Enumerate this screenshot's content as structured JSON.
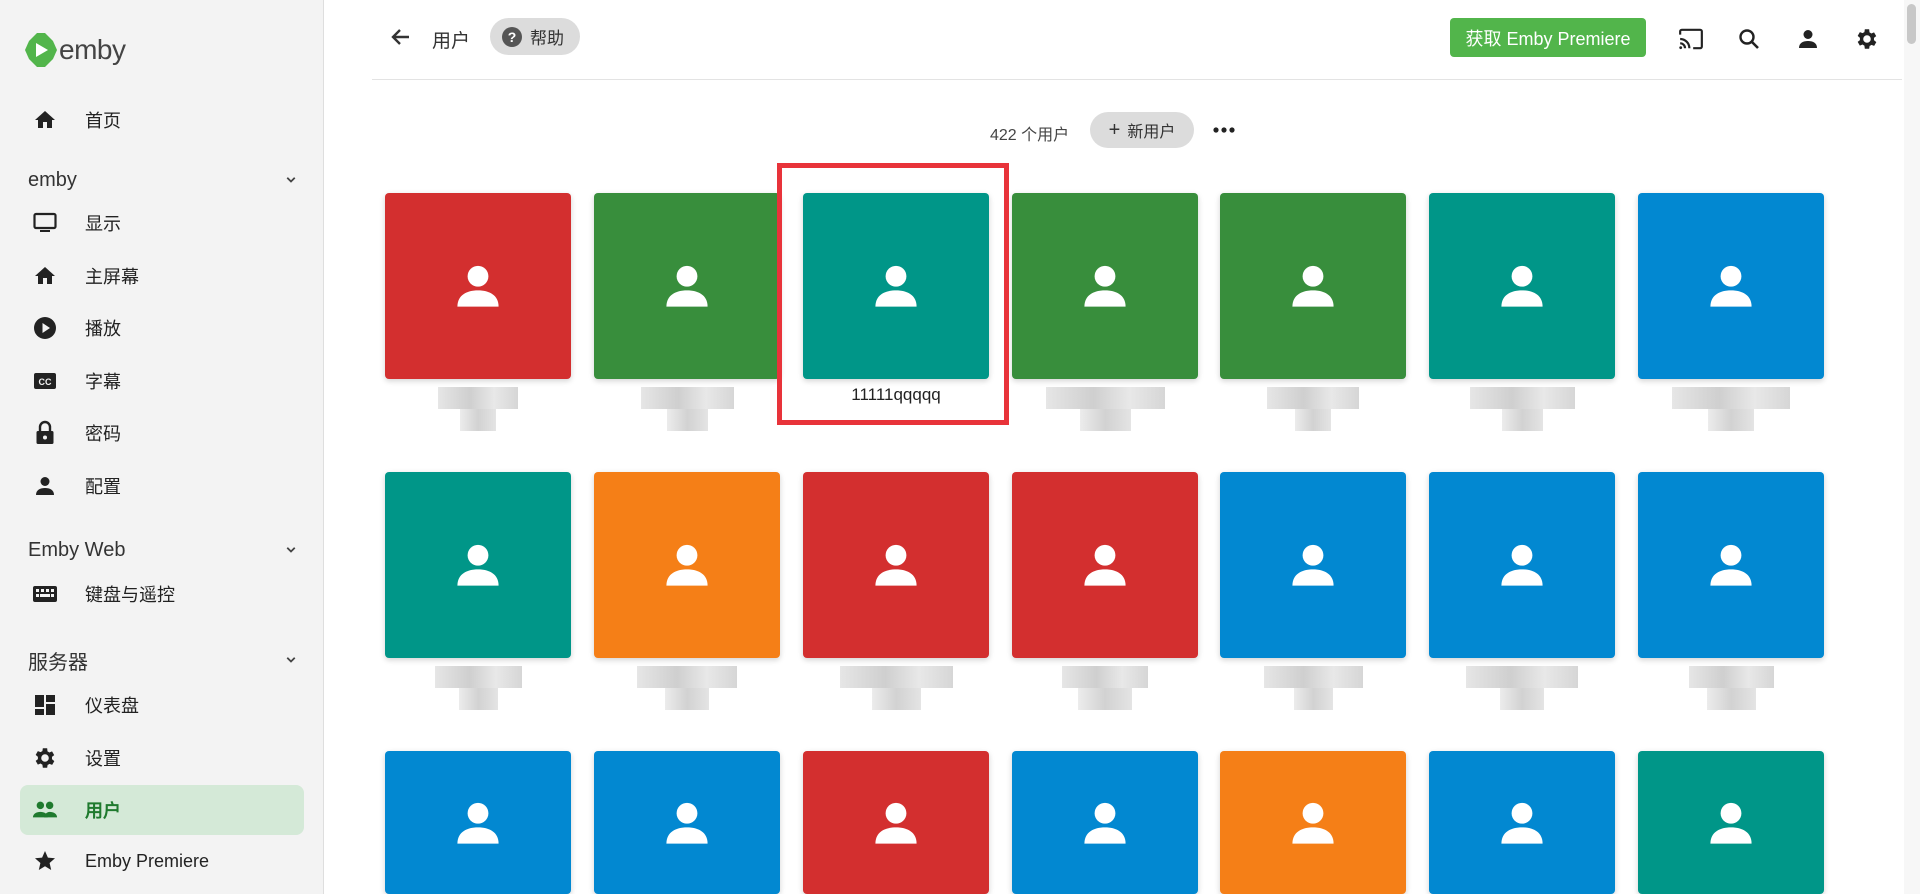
{
  "brand": {
    "logo_text": "emby",
    "logo_color": "#52b54b"
  },
  "sidebar": {
    "home": "首页",
    "sections": [
      {
        "title": "emby",
        "items": [
          {
            "label": "显示",
            "icon": "monitor-icon"
          },
          {
            "label": "主屏幕",
            "icon": "home-icon"
          },
          {
            "label": "播放",
            "icon": "play-circle-icon"
          },
          {
            "label": "字幕",
            "icon": "closed-caption-icon"
          },
          {
            "label": "密码",
            "icon": "lock-icon"
          },
          {
            "label": "配置",
            "icon": "person-icon"
          }
        ]
      },
      {
        "title": "Emby Web",
        "items": [
          {
            "label": "键盘与遥控",
            "icon": "keyboard-icon"
          }
        ]
      },
      {
        "title": "服务器",
        "items": [
          {
            "label": "仪表盘",
            "icon": "dashboard-icon"
          },
          {
            "label": "设置",
            "icon": "gear-icon"
          },
          {
            "label": "用户",
            "icon": "people-icon",
            "active": true
          },
          {
            "label": "Emby Premiere",
            "icon": "star-icon"
          }
        ]
      }
    ]
  },
  "header": {
    "title": "用户",
    "help_label": "帮助",
    "premiere_label": "获取 Emby Premiere",
    "accent": "#52b54b"
  },
  "toolbar": {
    "count": "422 个用户",
    "new_user_label": "新用户"
  },
  "users": {
    "highlighted_name": "11111qqqqq",
    "colors": [
      "#d32f2f",
      "#388e3c",
      "#009688",
      "#0288d1",
      "#f57f17"
    ],
    "rows": [
      [
        "#d32f2f",
        "#388e3c",
        "#009688",
        "#388e3c",
        "#388e3c",
        "#009688",
        "#0288d1"
      ],
      [
        "#009688",
        "#f57f17",
        "#d32f2f",
        "#d32f2f",
        "#0288d1",
        "#0288d1",
        "#0288d1"
      ],
      [
        "#0288d1",
        "#0288d1",
        "#d32f2f",
        "#0288d1",
        "#f57f17",
        "#0288d1",
        "#009688"
      ]
    ]
  }
}
